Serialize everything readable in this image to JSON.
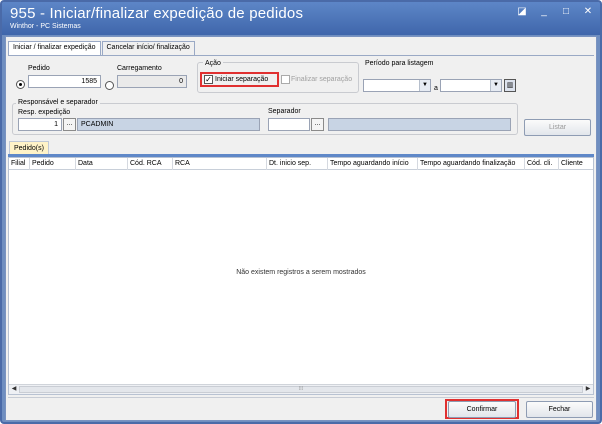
{
  "window": {
    "title": "955 - Iniciar/finalizar expedição de pedidos",
    "subtitle": "Winthor - PC Sistemas",
    "controls": [
      "◪",
      "_",
      "□",
      "✕"
    ]
  },
  "tabs": [
    "Iniciar / finalizar expedição",
    "Cancelar início/ finalização"
  ],
  "pedido": {
    "label": "Pedido",
    "value": "1585",
    "selected": true
  },
  "carregamento": {
    "label": "Carregamento",
    "value": "0",
    "selected": false
  },
  "acao": {
    "label": "Ação",
    "iniciar": {
      "label": "Iniciar separação",
      "checked": true
    },
    "finalizar": {
      "label": "Finalizar separação",
      "checked": false
    }
  },
  "periodo": {
    "label": "Período para listagem",
    "separator": "a"
  },
  "responsavel": {
    "group_label": "Responsável e separador",
    "resp_label": "Resp. expedição",
    "resp_code": "1",
    "resp_name": "PCADMIN",
    "separador_label": "Separador",
    "browse": "..."
  },
  "listar_label": "Listar",
  "subtab_label": "Pedido(s)",
  "grid": {
    "columns": [
      "Filial",
      "Pedido",
      "Data",
      "Cód. RCA",
      "RCA",
      "Dt. inicio sep.",
      "Tempo aguardando  início",
      "Tempo aguardando finalização",
      "Cód. cli.",
      "Cliente"
    ],
    "empty_message": "Não existem registros a serem mostrados"
  },
  "buttons": {
    "confirmar": "Confirmar",
    "fechar": "Fechar"
  },
  "colors": {
    "title_bar": "#3f66ab",
    "highlight": "#e03030",
    "accent": "#5f88c8"
  }
}
